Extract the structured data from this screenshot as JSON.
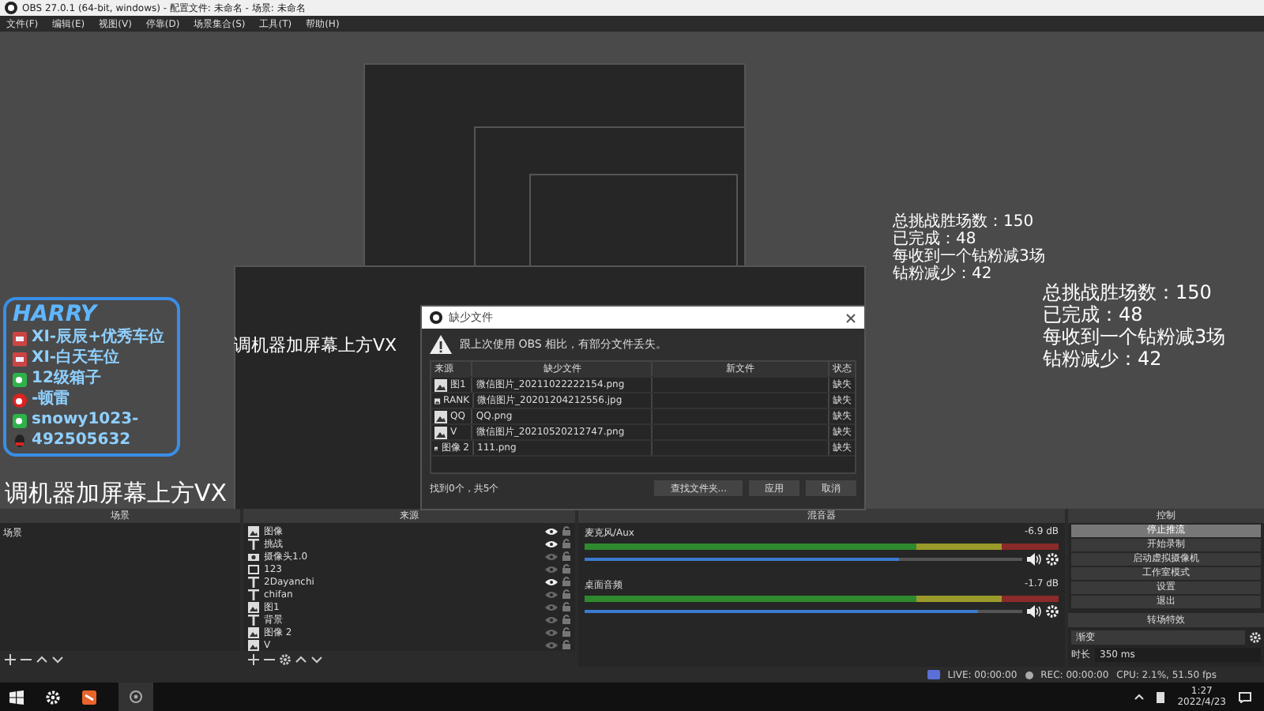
{
  "window": {
    "title": "OBS 27.0.1 (64-bit, windows) - 配置文件: 未命名 - 场景: 未命名"
  },
  "menu": [
    "文件(F)",
    "编辑(E)",
    "视图(V)",
    "停靠(D)",
    "场景集合(S)",
    "工具(T)",
    "帮助(H)"
  ],
  "preview": {
    "info_card": {
      "logo": "HARRY",
      "lines": [
        {
          "kind": "plain",
          "text": "XI-辰辰+优秀车位"
        },
        {
          "kind": "plain",
          "text": "XI-白天车位"
        },
        {
          "kind": "wechat",
          "text": "12级箱子"
        },
        {
          "kind": "weibo",
          "text": "-顿雷"
        },
        {
          "kind": "wechat",
          "text": "snowy1023-"
        },
        {
          "kind": "qq",
          "text": "492505632"
        }
      ]
    },
    "captions": [
      {
        "text": "调机器加屏幕上方VX"
      },
      {
        "text": "调机器加屏幕上方VX"
      }
    ],
    "stats": [
      {
        "lines": [
          "总挑战胜场数：150",
          "已完成：48",
          "每收到一个钻粉减3场",
          "钻粉减少：42"
        ]
      },
      {
        "lines": [
          "总挑战胜场数：150",
          "已完成：48",
          "每收到一个钻粉减3场",
          "钻粉减少：42"
        ]
      }
    ]
  },
  "dialog": {
    "title": "缺少文件",
    "message": "跟上次使用 OBS 相比，有部分文件丢失。",
    "columns": [
      "来源",
      "缺少文件",
      "新文件",
      "状态"
    ],
    "rows": [
      {
        "source": "图1",
        "missing": "微信图片_20211022222154.png",
        "status": "缺失"
      },
      {
        "source": "RANK",
        "missing": "微信图片_20201204212556.jpg",
        "status": "缺失"
      },
      {
        "source": "QQ",
        "missing": "QQ.png",
        "status": "缺失"
      },
      {
        "source": "V",
        "missing": "微信图片_20210520212747.png",
        "status": "缺失"
      },
      {
        "source": "图像 2",
        "missing": "111.png",
        "status": "缺失"
      }
    ],
    "found": "找到0个，共5个",
    "buttons": [
      "查找文件夹...",
      "应用",
      "取消"
    ]
  },
  "scenes": {
    "title": "场景",
    "items": [
      {
        "label": "场景",
        "selected": false
      }
    ]
  },
  "sources": {
    "title": "来源",
    "items": [
      {
        "kind": "image",
        "label": "图像",
        "visible": true
      },
      {
        "kind": "text",
        "label": "挑战",
        "visible": true
      },
      {
        "kind": "camera",
        "label": "摄像头1.0",
        "visible": false
      },
      {
        "kind": "window",
        "label": "123",
        "visible": false
      },
      {
        "kind": "text",
        "label": "2Dayanchi",
        "visible": true
      },
      {
        "kind": "text",
        "label": "chifan",
        "visible": false
      },
      {
        "kind": "image",
        "label": "图1",
        "visible": false
      },
      {
        "kind": "text",
        "label": "背景",
        "visible": false
      },
      {
        "kind": "image",
        "label": "图像 2",
        "visible": false
      },
      {
        "kind": "image",
        "label": "V",
        "visible": false
      }
    ]
  },
  "mixer": {
    "title": "混音器",
    "channels": [
      {
        "name": "麦克风/Aux",
        "reading": "-6.9 dB",
        "level": 0.72
      },
      {
        "name": "桌面音频",
        "reading": "-1.7 dB",
        "level": 0.9
      }
    ]
  },
  "controls": {
    "title": "控制",
    "buttons": [
      {
        "label": "停止推流",
        "selected": true
      },
      {
        "label": "开始录制",
        "selected": false
      },
      {
        "label": "启动虚拟摄像机",
        "selected": false
      },
      {
        "label": "工作室模式",
        "selected": false
      },
      {
        "label": "设置",
        "selected": false
      },
      {
        "label": "退出",
        "selected": false
      }
    ]
  },
  "transitions": {
    "title": "转场特效",
    "value": "渐变",
    "duration_label": "时长",
    "duration": "350 ms"
  },
  "status_bar": {
    "live": "LIVE: 00:00:00",
    "rec": "REC: 00:00:00",
    "cpu": "CPU: 2.1%, 51.50 fps"
  },
  "taskbar": {
    "time": "1:27",
    "date": "2022/4/23"
  }
}
